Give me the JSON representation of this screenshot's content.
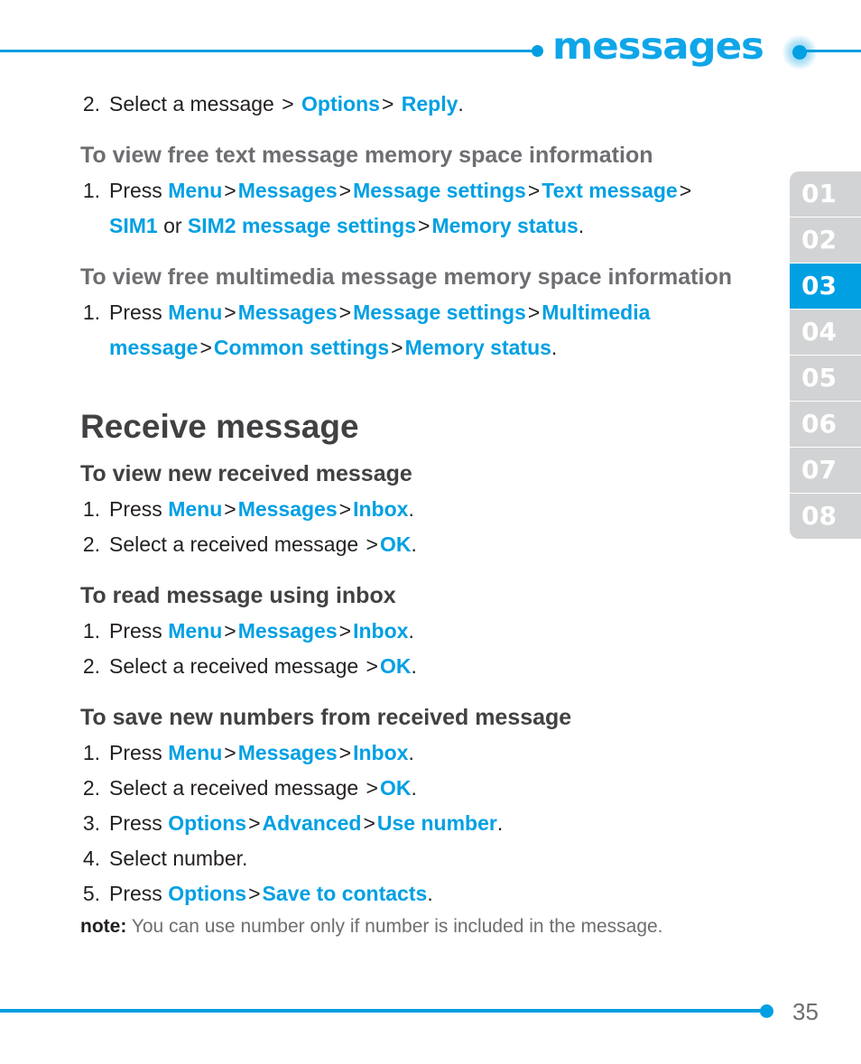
{
  "header": {
    "title": "messages",
    "left_dot": "bullet-dot",
    "right_dot": "bullet-dot",
    "accent_color": "#00a0e3"
  },
  "side_tabs": {
    "active_index": 2,
    "items": [
      {
        "label": "01"
      },
      {
        "label": "02"
      },
      {
        "label": "03"
      },
      {
        "label": "04"
      },
      {
        "label": "05"
      },
      {
        "label": "06"
      },
      {
        "label": "07"
      },
      {
        "label": "08"
      }
    ]
  },
  "content": {
    "top_step": {
      "num": "2.",
      "seg": [
        "Select a message ",
        ">",
        " Options",
        ">",
        " Reply",
        "."
      ]
    },
    "section_text_memory": {
      "heading": "To view free text message memory space information",
      "step_num": "1.",
      "line1": [
        "Press ",
        "Menu",
        ">",
        "Messages",
        ">",
        "Message settings",
        ">",
        "Text message",
        ">"
      ],
      "line2_a": "SIM1",
      "line2_or": " or ",
      "line2_b": "SIM2 message settings",
      "line2_gt": ">",
      "line2_c": "Memory status",
      "line2_end": "."
    },
    "section_mms_memory": {
      "heading": "To view free multimedia message memory space information",
      "step_num": "1.",
      "l1_press": "Press ",
      "l1_menu": "Menu",
      "l1_messages": "Messages",
      "l1_msgsettings": "Message settings",
      "l1_multimedia": "Multimedia",
      "l2_message": "message",
      "l2_common": "Common settings",
      "l2_memory": "Memory status",
      "l2_end": "."
    },
    "big_heading": "Receive message",
    "section_view_new": {
      "heading": "To view new received message",
      "s1_num": "1.",
      "s1_press": "Press ",
      "s1_menu": "Menu",
      "s1_messages": "Messages",
      "s1_inbox": "Inbox",
      "s1_end": ".",
      "s2_num": "2.",
      "s2_text": "Select a received message ",
      "s2_ok": "OK",
      "s2_end": "."
    },
    "section_read_inbox": {
      "heading": "To read message using inbox",
      "s1_num": "1.",
      "s1_press": "Press ",
      "s1_menu": "Menu",
      "s1_messages": "Messages",
      "s1_inbox": "Inbox",
      "s1_end": ".",
      "s2_num": "2.",
      "s2_text": "Select a received message ",
      "s2_ok": "OK",
      "s2_end": "."
    },
    "section_save_numbers": {
      "heading": "To save new numbers from received message",
      "s1_num": "1.",
      "s1_press": "Press ",
      "s1_menu": "Menu",
      "s1_messages": "Messages",
      "s1_inbox": "Inbox",
      "s1_end": ".",
      "s2_num": "2.",
      "s2_text": "Select a received message ",
      "s2_ok": "OK",
      "s2_end": ".",
      "s3_num": "3.",
      "s3_press": "Press ",
      "s3_options": "Options",
      "s3_advanced": "Advanced",
      "s3_usenumber": "Use number",
      "s3_end": ".",
      "s4_num": "4.",
      "s4_text": "Select number.",
      "s5_num": "5.",
      "s5_press": "Press ",
      "s5_options": "Options",
      "s5_save": "Save to contacts",
      "s5_end": ".",
      "note_label": "note:",
      "note_text": " You can use number only if number is included in the message."
    },
    "gt": ">"
  },
  "footer": {
    "page_number": "35",
    "dot": "bullet-dot"
  }
}
